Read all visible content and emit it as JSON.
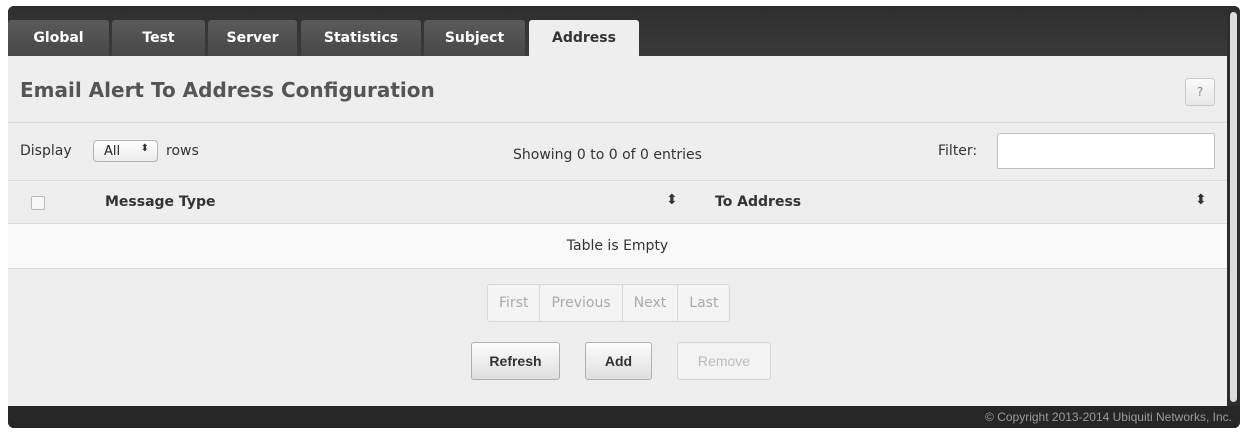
{
  "tabs": [
    {
      "label": "Global",
      "active": false
    },
    {
      "label": "Test",
      "active": false
    },
    {
      "label": "Server",
      "active": false
    },
    {
      "label": "Statistics",
      "active": false
    },
    {
      "label": "Subject",
      "active": false
    },
    {
      "label": "Address",
      "active": true
    }
  ],
  "page": {
    "title": "Email Alert To Address Configuration",
    "help_label": "?"
  },
  "controls": {
    "display_label": "Display",
    "rows_selected": "All",
    "rows_label": "rows",
    "showing_text": "Showing 0 to 0 of 0 entries",
    "filter_label": "Filter:",
    "filter_value": ""
  },
  "table": {
    "columns": [
      "Message Type",
      "To Address"
    ],
    "empty_text": "Table is Empty"
  },
  "pager": {
    "first": "First",
    "previous": "Previous",
    "next": "Next",
    "last": "Last"
  },
  "actions": {
    "refresh": "Refresh",
    "add": "Add",
    "remove": "Remove"
  },
  "footer": {
    "copyright": "© Copyright 2013-2014 Ubiquiti Networks, Inc."
  },
  "icons": {
    "sort": "sort-icon",
    "select_arrows": "select-arrows-icon",
    "help": "help-icon"
  }
}
